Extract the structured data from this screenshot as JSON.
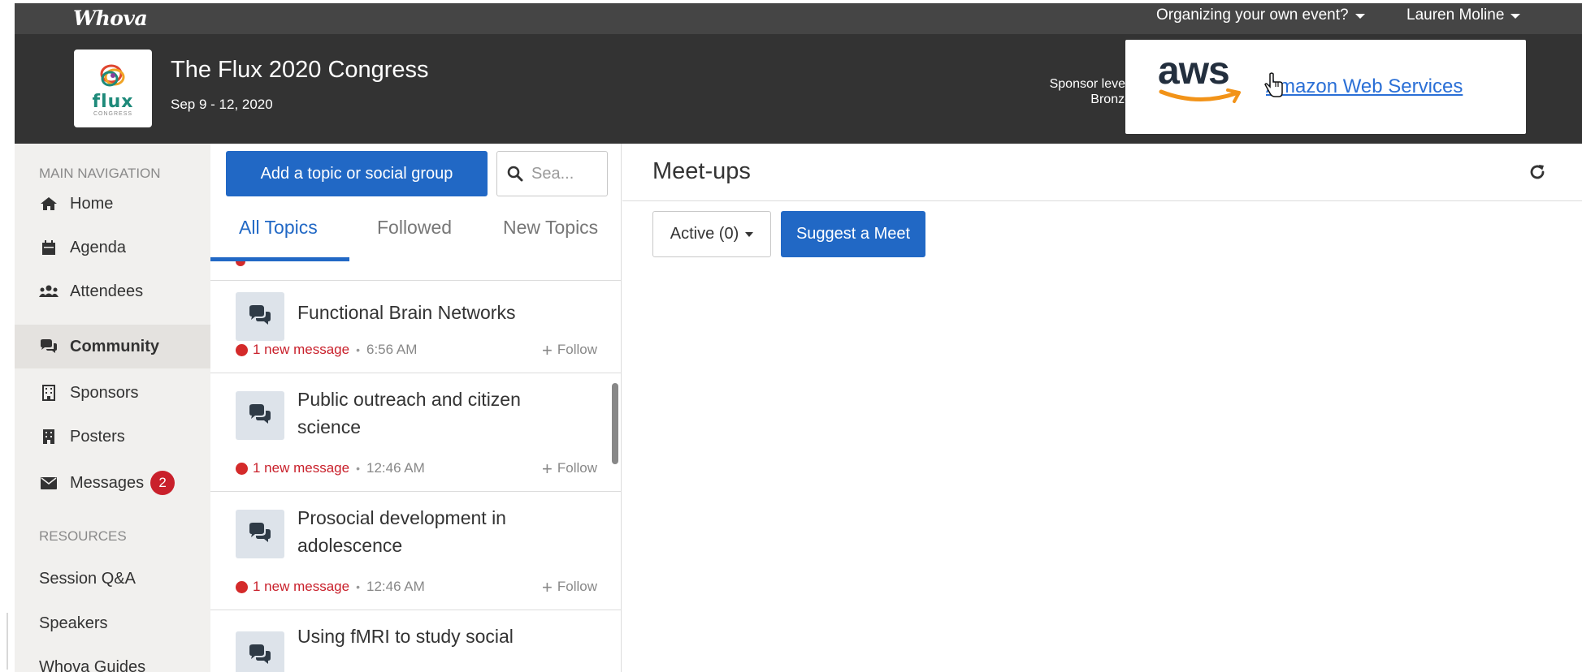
{
  "topbar": {
    "brand": "Whova",
    "organize_link": "Organizing your own event?",
    "user_name": "Lauren Moline"
  },
  "header": {
    "event_title": "The Flux 2020 Congress",
    "event_dates": "Sep 9 - 12, 2020",
    "logo_word": "flux",
    "logo_sub": "CONGRESS",
    "sponsor_level_label": "Sponsor level:",
    "sponsor_level_value": "Bronze",
    "sponsor_logo_text": "aws",
    "sponsor_name": "Amazon Web Services"
  },
  "sidebar": {
    "main_heading": "MAIN NAVIGATION",
    "items": [
      {
        "label": "Home",
        "icon": "home-icon"
      },
      {
        "label": "Agenda",
        "icon": "calendar-icon"
      },
      {
        "label": "Attendees",
        "icon": "users-icon"
      },
      {
        "label": "Community",
        "icon": "chat-icon",
        "active": true
      },
      {
        "label": "Sponsors",
        "icon": "building-icon"
      },
      {
        "label": "Posters",
        "icon": "building-icon"
      },
      {
        "label": "Messages",
        "icon": "envelope-icon",
        "badge": "2"
      }
    ],
    "resources_heading": "RESOURCES",
    "resources": [
      "Session Q&A",
      "Speakers",
      "Whova Guides"
    ]
  },
  "community": {
    "add_topic_label": "Add a topic or social group",
    "search_placeholder": "Sea...",
    "tabs": [
      "All Topics",
      "Followed",
      "New Topics"
    ],
    "topics": [
      {
        "title": "Functional Brain Networks",
        "new_message": "1 new message",
        "time": "6:56 AM",
        "follow": "Follow"
      },
      {
        "title": "Public outreach and citizen science",
        "new_message": "1 new message",
        "time": "12:46 AM",
        "follow": "Follow"
      },
      {
        "title": "Prosocial development in adolescence",
        "new_message": "1 new message",
        "time": "12:46 AM",
        "follow": "Follow"
      },
      {
        "title": "Using fMRI to study social",
        "new_message": "",
        "time": "",
        "follow": ""
      }
    ]
  },
  "meetups": {
    "title": "Meet-ups",
    "active_filter": "Active (0)",
    "suggest_label": "Suggest a Meet"
  },
  "colors": {
    "primary_blue": "#2168c5",
    "header_dark": "#333333",
    "alert_red": "#c9202b"
  }
}
